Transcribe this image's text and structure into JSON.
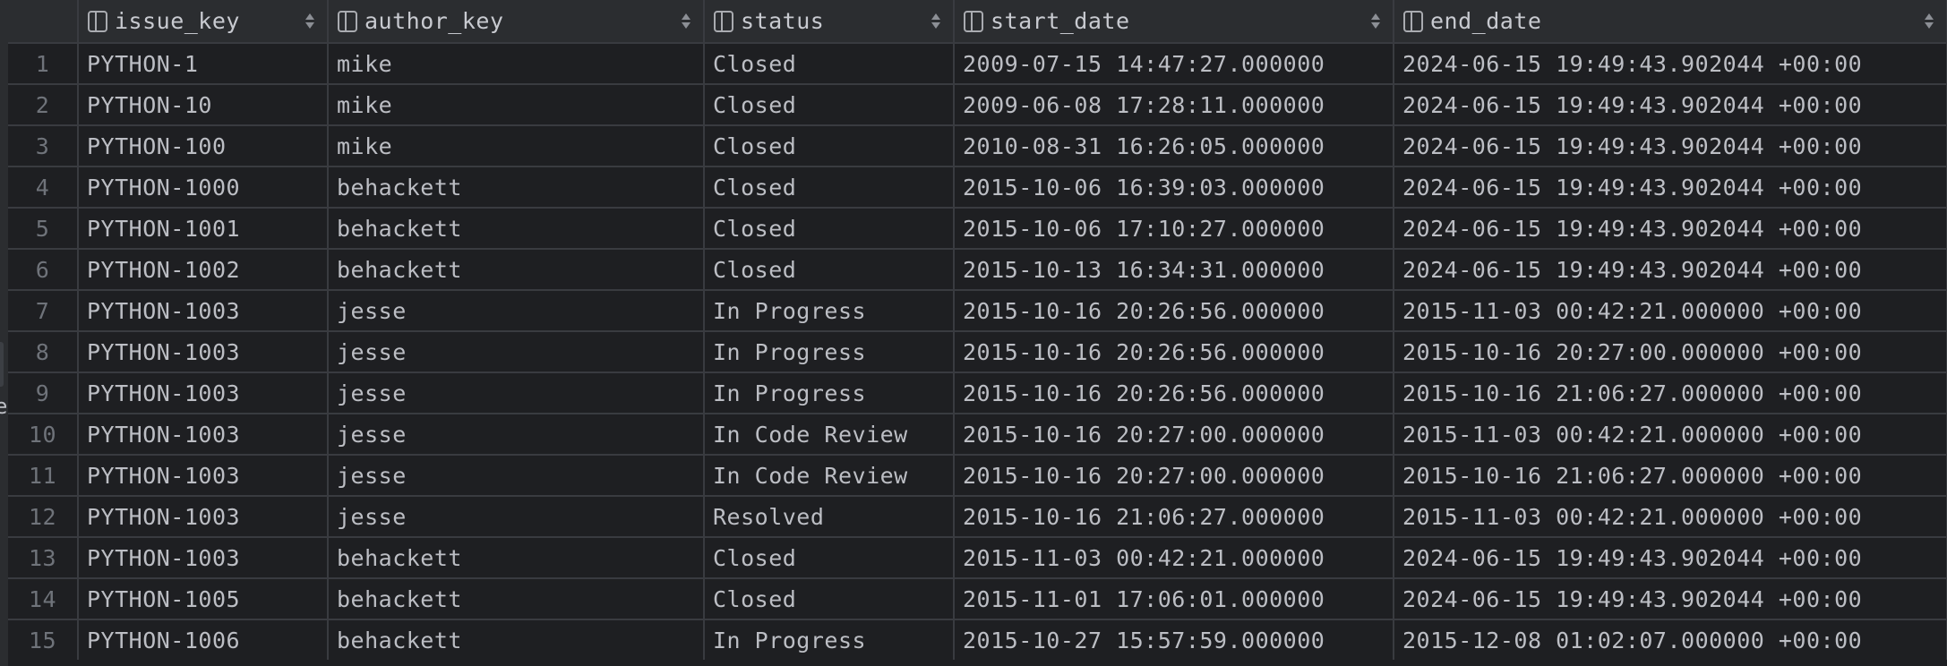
{
  "columns": [
    {
      "key": "issue_key",
      "label": "issue_key"
    },
    {
      "key": "author_key",
      "label": "author_key"
    },
    {
      "key": "status",
      "label": "status"
    },
    {
      "key": "start_date",
      "label": "start_date"
    },
    {
      "key": "end_date",
      "label": "end_date"
    }
  ],
  "rows": [
    [
      "1",
      "PYTHON-1",
      "mike",
      "Closed",
      "2009-07-15 14:47:27.000000",
      "2024-06-15 19:49:43.902044 +00:00"
    ],
    [
      "2",
      "PYTHON-10",
      "mike",
      "Closed",
      "2009-06-08 17:28:11.000000",
      "2024-06-15 19:49:43.902044 +00:00"
    ],
    [
      "3",
      "PYTHON-100",
      "mike",
      "Closed",
      "2010-08-31 16:26:05.000000",
      "2024-06-15 19:49:43.902044 +00:00"
    ],
    [
      "4",
      "PYTHON-1000",
      "behackett",
      "Closed",
      "2015-10-06 16:39:03.000000",
      "2024-06-15 19:49:43.902044 +00:00"
    ],
    [
      "5",
      "PYTHON-1001",
      "behackett",
      "Closed",
      "2015-10-06 17:10:27.000000",
      "2024-06-15 19:49:43.902044 +00:00"
    ],
    [
      "6",
      "PYTHON-1002",
      "behackett",
      "Closed",
      "2015-10-13 16:34:31.000000",
      "2024-06-15 19:49:43.902044 +00:00"
    ],
    [
      "7",
      "PYTHON-1003",
      "jesse",
      "In Progress",
      "2015-10-16 20:26:56.000000",
      "2015-11-03 00:42:21.000000 +00:00"
    ],
    [
      "8",
      "PYTHON-1003",
      "jesse",
      "In Progress",
      "2015-10-16 20:26:56.000000",
      "2015-10-16 20:27:00.000000 +00:00"
    ],
    [
      "9",
      "PYTHON-1003",
      "jesse",
      "In Progress",
      "2015-10-16 20:26:56.000000",
      "2015-10-16 21:06:27.000000 +00:00"
    ],
    [
      "10",
      "PYTHON-1003",
      "jesse",
      "In Code Review",
      "2015-10-16 20:27:00.000000",
      "2015-11-03 00:42:21.000000 +00:00"
    ],
    [
      "11",
      "PYTHON-1003",
      "jesse",
      "In Code Review",
      "2015-10-16 20:27:00.000000",
      "2015-10-16 21:06:27.000000 +00:00"
    ],
    [
      "12",
      "PYTHON-1003",
      "jesse",
      "Resolved",
      "2015-10-16 21:06:27.000000",
      "2015-11-03 00:42:21.000000 +00:00"
    ],
    [
      "13",
      "PYTHON-1003",
      "behackett",
      "Closed",
      "2015-11-03 00:42:21.000000",
      "2024-06-15 19:49:43.902044 +00:00"
    ],
    [
      "14",
      "PYTHON-1005",
      "behackett",
      "Closed",
      "2015-11-01 17:06:01.000000",
      "2024-06-15 19:49:43.902044 +00:00"
    ],
    [
      "15",
      "PYTHON-1006",
      "behackett",
      "In Progress",
      "2015-10-27 15:57:59.000000",
      "2015-12-08 01:02:07.000000 +00:00"
    ]
  ],
  "left_panel_fragment": "e"
}
